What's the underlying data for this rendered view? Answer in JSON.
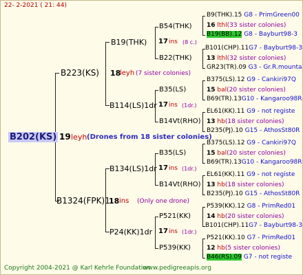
{
  "header": {
    "date": "22-  2-2021  ( 21: 44)"
  },
  "root": {
    "name": "B202(KS)",
    "gen": "19",
    "note": "leyh",
    "desc": "(Drones from 18 sister colonies)"
  },
  "gen1": [
    {
      "name": "B223(KS)",
      "gen": "18",
      "note": "leyh",
      "desc": "(7 sister colonies)"
    },
    {
      "name": "B1324(FPK)1",
      "gen": "18",
      "note": "ins",
      "desc": "(Only one drone)"
    }
  ],
  "gen2": [
    {
      "name": "B19(THK)",
      "gen": "17",
      "note": "ins",
      "desc": "(8 c.)"
    },
    {
      "name": "B114(LS)1dr",
      "gen": "17",
      "note": "ins",
      "desc": "(1dr.)"
    },
    {
      "name": "B134(LS)1dr",
      "gen": "17",
      "note": "ins",
      "desc": "(1dr.)"
    },
    {
      "name": "P24(KK)1dr",
      "gen": "17",
      "note": "ins",
      "desc": "(1dr.)"
    }
  ],
  "gen3": [
    {
      "name": "B54(THK)",
      "gen": "16",
      "note": "lthl",
      "desc": "(33 sister colonies)"
    },
    {
      "name": "B22(THK)",
      "gen": "13",
      "note": "lthl",
      "desc": "(32 sister colonies)"
    },
    {
      "name": "B35(LS)",
      "gen": "15",
      "note": "bal",
      "desc": "(20 sister colonies)"
    },
    {
      "name": "B14Vt(RHO)",
      "gen": "13",
      "note": "hb",
      "desc": "(18 sister colonies)"
    },
    {
      "name": "B35(LS)",
      "gen": "15",
      "note": "bal",
      "desc": "(20 sister colonies)"
    },
    {
      "name": "B14Vt(RHO)",
      "gen": "13",
      "note": "hb",
      "desc": "(18 sister colonies)"
    },
    {
      "name": "P521(KK)",
      "gen": "14",
      "note": "hb",
      "desc": "(20 sister colonies)"
    },
    {
      "name": "P539(KK)",
      "gen": "12",
      "note": "hb",
      "desc": "(5 sister colonies)"
    }
  ],
  "gen4": [
    {
      "name": "B9(THK).15",
      "info": "G8 - PrimGreen00"
    },
    {
      "name": "B19(BB).12",
      "info": "G8 - Bayburt98-3"
    },
    {
      "name": "B101(CHP).11",
      "info": "G7 - Bayburt98-3"
    },
    {
      "name": "GR23(TR).09",
      "info": "G3 - Gr.R.mounta"
    },
    {
      "name": "B375(LS).12",
      "info": "G9 - Cankiri97Q"
    },
    {
      "name": "B69(TR).13",
      "info": "G10 - Kangaroo98R"
    },
    {
      "name": "EL61(KK).11",
      "info": "G9 - not registe"
    },
    {
      "name": "B235(PJ).10",
      "info": "G15 - AthosSt80R"
    },
    {
      "name": "B375(LS).12",
      "info": "G9 - Cankiri97Q"
    },
    {
      "name": "B69(TR).13",
      "info": "G10 - Kangaroo98R"
    },
    {
      "name": "EL61(KK).11",
      "info": "G9 - not registe"
    },
    {
      "name": "B235(PJ).10",
      "info": "G15 - AthosSt80R"
    },
    {
      "name": "P539(KK).12",
      "info": "G8 - PrimRed01"
    },
    {
      "name": "B101(CHP).11",
      "info": "G7 - Bayburt98-3"
    },
    {
      "name": "P521(KK).10",
      "info": "G7 - PrimRed01"
    },
    {
      "name": "B46(RS).09",
      "info": "G7 - not registe"
    }
  ],
  "footer": {
    "copyright": "Copyright 2004-2021 @ Karl Kehrle Foundation",
    "url": "www.pedigreeapis.org"
  },
  "colors": {
    "background": "#fffbe9",
    "highlight": "#2ec82e",
    "root_bg": "#c9c9f5"
  }
}
